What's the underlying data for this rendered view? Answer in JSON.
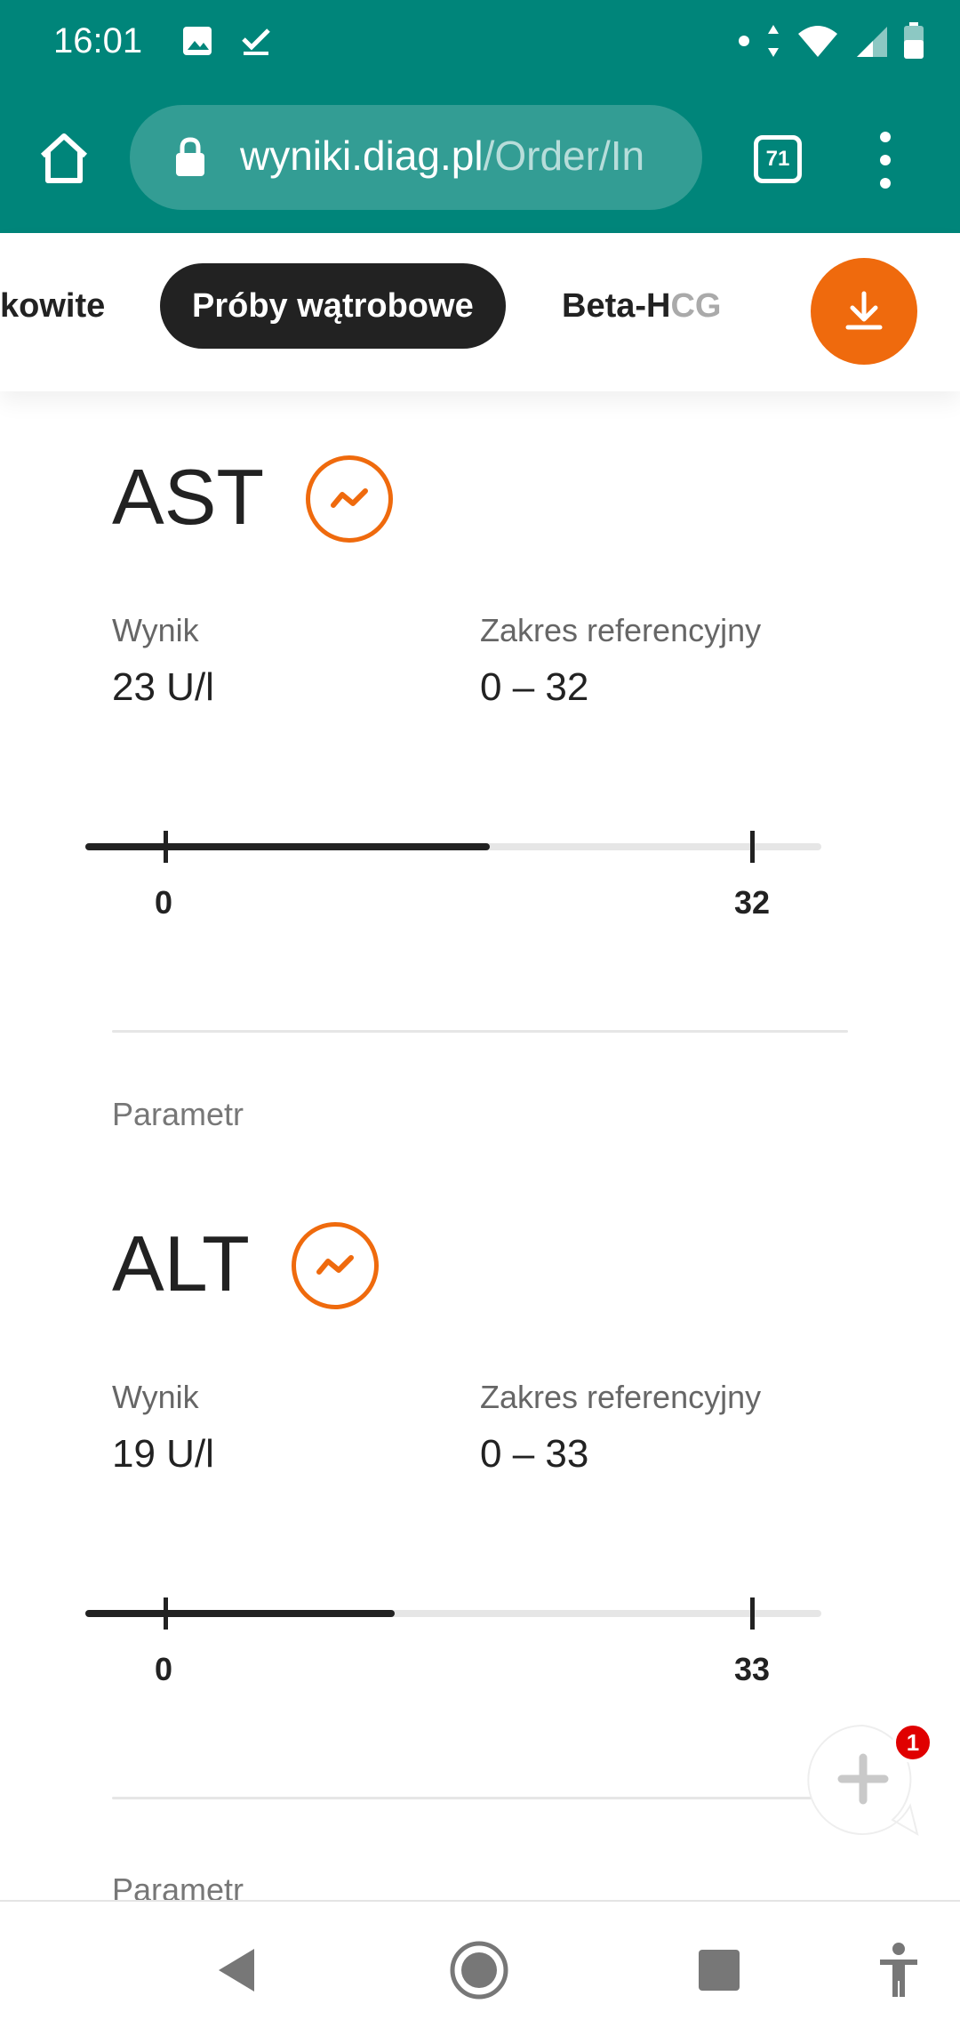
{
  "status_bar": {
    "time": "16:01"
  },
  "browser": {
    "url_domain": "wyniki.diag.pl",
    "url_path": "/Order/In",
    "tab_count": "71"
  },
  "categories": {
    "left_partial": "kowite",
    "active": "Próby wątrobowe",
    "right_partial_dark": "Beta-H",
    "right_partial_faded": "CG"
  },
  "params": [
    {
      "name": "AST",
      "result_label": "Wynik",
      "result_value": "23 U/l",
      "range_label": "Zakres referencyjny",
      "range_value": "0 – 32",
      "range_min": "0",
      "range_max": "32",
      "fill_fraction": 0.55
    },
    {
      "param_label": "Parametr",
      "name": "ALT",
      "result_label": "Wynik",
      "result_value": "19 U/l",
      "range_label": "Zakres referencyjny",
      "range_value": "0 – 33",
      "range_min": "0",
      "range_max": "33",
      "fill_fraction": 0.42
    },
    {
      "param_label": "Parametr"
    }
  ],
  "chat": {
    "badge": "1"
  },
  "colors": {
    "accent": "#ef6a0d",
    "toolbar": "#00857a",
    "dark": "#222222"
  }
}
